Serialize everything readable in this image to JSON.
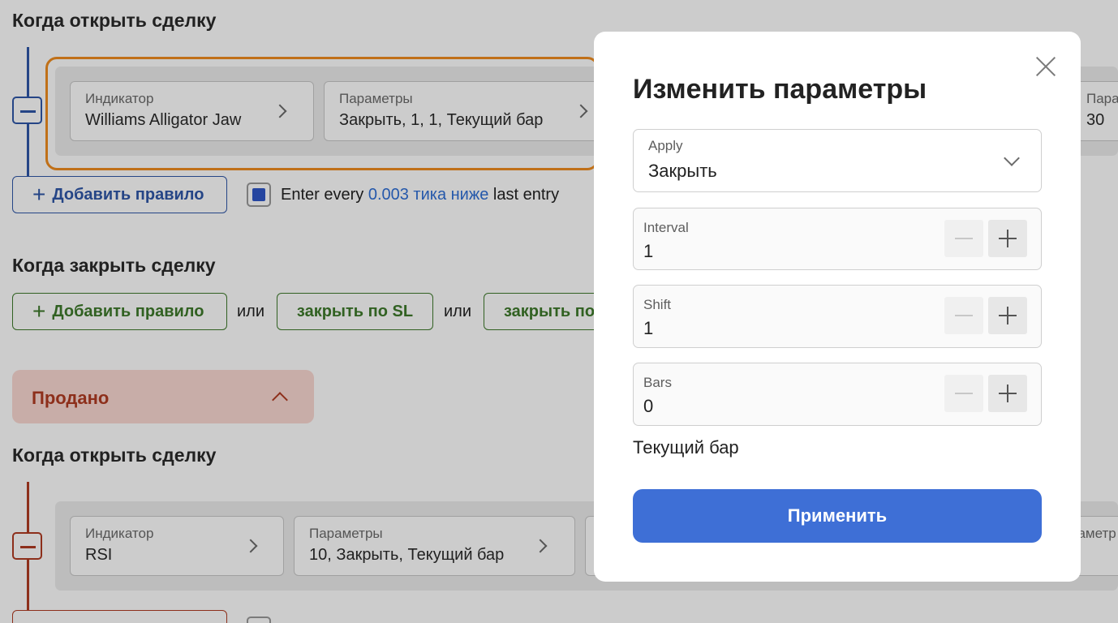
{
  "background": {
    "section_open_title": "Когда открыть сделку",
    "rule1": {
      "indicator_label": "Индикатор",
      "indicator_value": "Williams Alligator Jaw",
      "params_label": "Параметры",
      "params_value": "Закрыть, 1, 1, Текущий бар",
      "extra_label": "Пара",
      "extra_value": "30"
    },
    "add_rule_label": "Добавить правило",
    "enter_every": {
      "prefix": "Enter every",
      "link": "0.003 тика ниже",
      "suffix": "last entry"
    },
    "section_close_title": "Когда закрыть сделку",
    "close_add_rule_label": "Добавить правило",
    "or_1": "или",
    "close_sl_label": "закрыть по SL",
    "or_2": "или",
    "close_tp_label": "закрыть по",
    "sold_label": "Продано",
    "section_open_title_2": "Когда открыть сделку",
    "rule2": {
      "indicator_label": "Индикатор",
      "indicator_value": "RSI",
      "params_label": "Параметры",
      "params_value": "10, Закрыть, Текущий бар",
      "extra_label": "раметр"
    }
  },
  "modal": {
    "title": "Изменить параметры",
    "apply_field": {
      "label": "Apply",
      "value": "Закрыть"
    },
    "interval": {
      "label": "Interval",
      "value": "1"
    },
    "shift": {
      "label": "Shift",
      "value": "1"
    },
    "bars": {
      "label": "Bars",
      "value": "0"
    },
    "bar_note": "Текущий бар",
    "apply_button": "Применить"
  },
  "colors": {
    "accent_blue": "#3e6fd6",
    "link_blue": "#2f6fd6",
    "green": "#3e7a2b",
    "red": "#b13b22",
    "highlight": "#f08c1e"
  }
}
